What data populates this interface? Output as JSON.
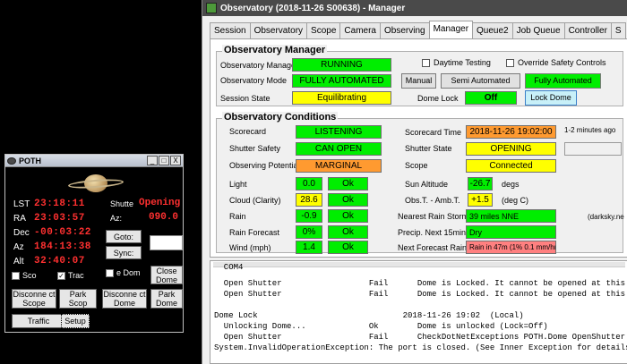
{
  "poth": {
    "title": "POTH",
    "min": "_",
    "max": "□",
    "close": "X",
    "lst_label": "LST",
    "lst_value": "23:18:11",
    "ra_label": "RA",
    "ra_value": "23:03:57",
    "dec_label": "Dec",
    "dec_value": "-00:03:22",
    "az_label": "Az",
    "az_value": "184:13:38",
    "alt_label": "Alt",
    "alt_value": "32:40:07",
    "shutter_label": "Shutte",
    "shutter_value": "Opening",
    "az2_label": "Az:",
    "az2_value": "090.0",
    "goto": "Goto:",
    "sync": "Sync:",
    "sco_chk": "Sco",
    "chk2_mark": "✓",
    "chk2_label": "Trac",
    "dom_chk": "e Dom",
    "close_scope": "Close Dome",
    "disconnect_scope": "Disconne ct Scope",
    "park_scope": "Park Scop",
    "disconnect_dome": "Disconne ct Dome",
    "park_dome": "Park Dome",
    "traffic": "Traffic",
    "setup": "Setup"
  },
  "manager": {
    "title": "Observatory (2018-11-26 S00638) - Manager",
    "tabs": [
      "Session",
      "Observatory",
      "Scope",
      "Camera",
      "Observing",
      "Manager",
      "Queue2",
      "Job Queue",
      "Controller",
      "S"
    ],
    "obs_manager": {
      "group_title": "Observatory Manager",
      "mgr_label": "Observatory Manager",
      "mgr_value": "RUNNING",
      "mode_label": "Observatory Mode",
      "mode_value": "FULLY AUTOMATED",
      "state_label": "Session State",
      "state_value": "Equilibrating",
      "daytime_testing": "Daytime Testing",
      "override_safety": "Override Safety Controls",
      "btn_manual": "Manual",
      "btn_semi": "Semi Automated",
      "btn_fully": "Fully Automated",
      "dome_lock_label": "Dome Lock",
      "dome_lock_value": "Off",
      "btn_lock_dome": "Lock Dome"
    },
    "obs_conditions": {
      "group_title": "Observatory Conditions",
      "scorecard_label": "Scorecard",
      "scorecard_value": "LISTENING",
      "scorecard_time_label": "Scorecard Time",
      "scorecard_time_value": "2018-11-26 19:02:00",
      "scorecard_note": "1-2 minutes ago",
      "shutter_safety_label": "Shutter Safety",
      "shutter_safety_value": "CAN OPEN",
      "shutter_state_label": "Shutter State",
      "shutter_state_value": "OPENING",
      "obs_potential_label": "Observing Potential",
      "obs_potential_value": "MARGINAL",
      "scope_label": "Scope",
      "scope_value": "Connected",
      "light_label": "Light",
      "light_value": "0.0",
      "light_status": "Ok",
      "cloud_label": "Cloud (Clarity)",
      "cloud_value": "28.6",
      "cloud_status": "Ok",
      "rain_label": "Rain",
      "rain_value": "-0.9",
      "rain_status": "Ok",
      "rain_forecast_label": "Rain Forecast",
      "rain_forecast_value": "0%",
      "rain_forecast_status": "Ok",
      "wind_label": "Wind (mph)",
      "wind_value": "1.4",
      "wind_status": "Ok",
      "sun_alt_label": "Sun Altitude",
      "sun_alt_value": "-26.7",
      "sun_alt_unit": "degs",
      "obst_amb_label": "Obs.T. - Amb.T.",
      "obst_amb_value": "+1.5",
      "obst_amb_unit": "(deg C)",
      "nearest_storm_label": "Nearest Rain Storm",
      "nearest_storm_value": "39 miles NNE",
      "darksky": "(darksky.ne",
      "precip_label": "Precip. Next 15mins",
      "precip_value": "Dry",
      "next_rain_label": "Next Forecast Rain",
      "next_rain_value": "Rain in 47m (1%  0.1 mm/hr)"
    },
    "log_lines": [
      "  COM4",
      "  Open Shutter                  Fail      Dome is Locked. It cannot be opened at this time",
      "  Open Shutter                  Fail      Dome is Locked. It cannot be opened at this time",
      "",
      "Dome Lock                              2018-11-26 19:02  (Local)",
      "  Unlocking Dome...             Ok        Dome is unlocked (Lock=Off)",
      "  Open Shutter                  Fail      CheckDotNetExceptions POTH.Dome OpenShutter",
      "System.InvalidOperationException: The port is closed. (See Inner Exception for details)"
    ]
  },
  "colors": {
    "green": "#00ee00",
    "yellow": "#ffff00",
    "orange": "#ff9a30",
    "lightred": "#ff8080",
    "led_red": "#ff3030"
  }
}
